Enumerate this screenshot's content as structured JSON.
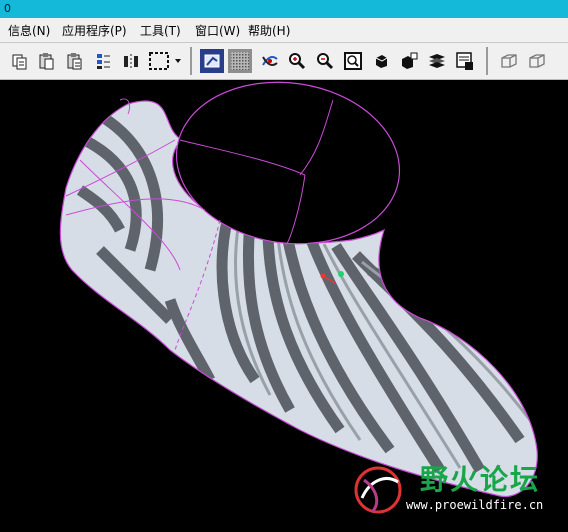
{
  "window": {
    "title": "0"
  },
  "menu": {
    "items": [
      {
        "label": "信息(N)"
      },
      {
        "label": "应用程序(P)"
      },
      {
        "label": "工具(T)"
      },
      {
        "label": "窗口(W)"
      },
      {
        "label": "帮助(H)"
      }
    ]
  },
  "toolbar": {
    "buttons": [
      {
        "icon": "copy-icon"
      },
      {
        "icon": "paste-icon"
      },
      {
        "icon": "paste-special-icon"
      },
      {
        "icon": "regenerate-icon"
      },
      {
        "icon": "mirror-icon"
      },
      {
        "icon": "select-box-icon"
      },
      {
        "icon": "shading-icon"
      },
      {
        "icon": "wireframe-icon"
      },
      {
        "icon": "spin-icon"
      },
      {
        "icon": "zoom-in-icon"
      },
      {
        "icon": "zoom-out-icon"
      },
      {
        "icon": "refit-icon"
      },
      {
        "icon": "orient-icon"
      },
      {
        "icon": "saved-views-icon"
      },
      {
        "icon": "layers-icon"
      },
      {
        "icon": "view-manager-icon"
      },
      {
        "icon": "box-view-1-icon"
      },
      {
        "icon": "box-view-2-icon"
      }
    ]
  },
  "watermark": {
    "title": "野火论坛",
    "url": "www.proewildfire.cn"
  },
  "colors": {
    "title_bar": "#14b8d9",
    "curve": "#c94bd6",
    "surface_light": "#d7dde6",
    "surface_dark": "#5f636b"
  }
}
